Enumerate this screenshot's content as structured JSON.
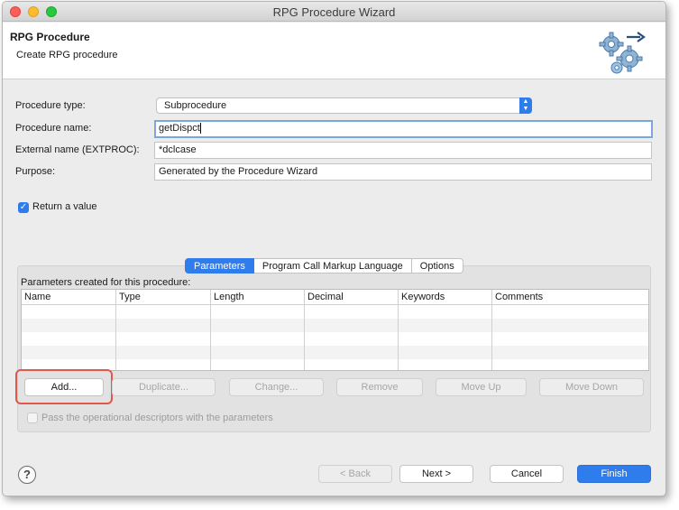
{
  "window": {
    "title": "RPG Procedure Wizard"
  },
  "banner": {
    "title": "RPG Procedure",
    "subtitle": "Create RPG procedure",
    "icon": "gear-arrow-icon"
  },
  "form": {
    "procedure_type_label": "Procedure type:",
    "procedure_type_value": "Subprocedure",
    "procedure_name_label": "Procedure name:",
    "procedure_name_value": "getDispct",
    "external_name_label": "External name (EXTPROC):",
    "external_name_value": "*dclcase",
    "purpose_label": "Purpose:",
    "purpose_value": "Generated by the Procedure Wizard",
    "return_value_label": "Return a value",
    "return_value_checked": true
  },
  "tabs": [
    {
      "label": "Parameters",
      "active": true
    },
    {
      "label": "Program Call Markup Language",
      "active": false
    },
    {
      "label": "Options",
      "active": false
    }
  ],
  "parameters": {
    "caption": "Parameters created for this procedure:",
    "columns": [
      "Name",
      "Type",
      "Length",
      "Decimal",
      "Keywords",
      "Comments"
    ],
    "rows": [],
    "buttons": {
      "add": "Add...",
      "duplicate": "Duplicate...",
      "change": "Change...",
      "remove": "Remove",
      "move_up": "Move Up",
      "move_down": "Move Down"
    },
    "pass_descriptors_label": "Pass the operational descriptors with the parameters",
    "pass_descriptors_checked": false
  },
  "footer": {
    "help": "?",
    "back": "< Back",
    "next": "Next >",
    "cancel": "Cancel",
    "finish": "Finish"
  },
  "colors": {
    "accent": "#2f7ded",
    "highlight": "#e2574c"
  }
}
